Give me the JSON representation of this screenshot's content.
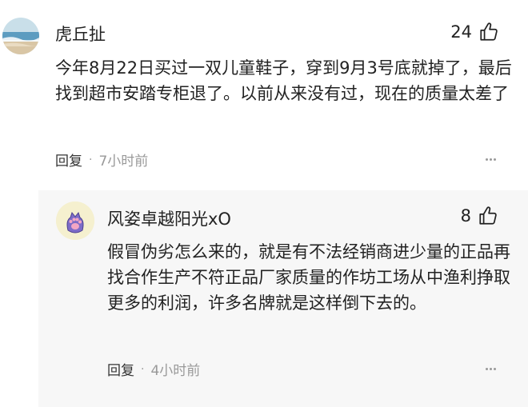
{
  "comments": [
    {
      "username": "虎丘扯",
      "likes": "24",
      "text": "今年8月22日买过一双儿童鞋子，穿到9月3号底就掉了，最后找到超市安踏专柜退了。以前从来没有过，现在的质量太差了",
      "reply_label": "回复",
      "separator": "·",
      "time": "7小时前",
      "avatar_icon": "beach-avatar"
    }
  ],
  "replies": [
    {
      "username": "风姿卓越阳光xO",
      "likes": "8",
      "text": "假冒伪劣怎么来的，就是有不法经销商进少量的正品再找合作生产不符正品厂家质量的作坊工场从中渔利挣取更多的利润，许多名牌就是这样倒下去的。",
      "reply_label": "回复",
      "separator": "·",
      "time": "4小时前",
      "avatar_icon": "cat-paw-avatar"
    }
  ],
  "icons": {
    "like": "thumbs-up-icon",
    "more": "more-dots-icon"
  },
  "colors": {
    "text": "#222222",
    "muted": "#999999",
    "reply_bg": "#f7f7f7"
  }
}
